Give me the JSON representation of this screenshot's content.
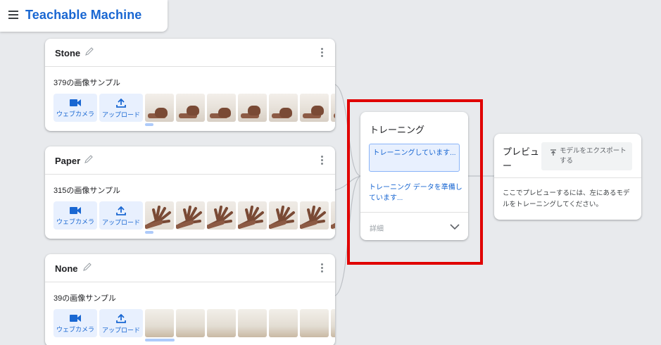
{
  "app": {
    "title": "Teachable Machine"
  },
  "classes": [
    {
      "name": "Stone",
      "samples_label": "379の画像サンプル",
      "thumb_style": "stone"
    },
    {
      "name": "Paper",
      "samples_label": "315の画像サンプル",
      "thumb_style": "paper"
    },
    {
      "name": "None",
      "samples_label": "39の画像サンプル",
      "thumb_style": "none"
    }
  ],
  "buttons": {
    "webcam_label": "ウェブカメラ",
    "upload_label": "アップロード"
  },
  "training": {
    "title": "トレーニング",
    "button_label": "トレーニングしています...",
    "status_text": "トレーニング データを準備しています...",
    "advanced_label": "詳細"
  },
  "preview": {
    "title": "プレビュー",
    "export_label": "モデルをエクスポートする",
    "message": "ここでプレビューするには、左にあるモデルをトレーニングしてください。"
  },
  "colors": {
    "accent": "#1967d2",
    "tile_bg": "#e8f0fe",
    "highlight": "#e00000"
  }
}
